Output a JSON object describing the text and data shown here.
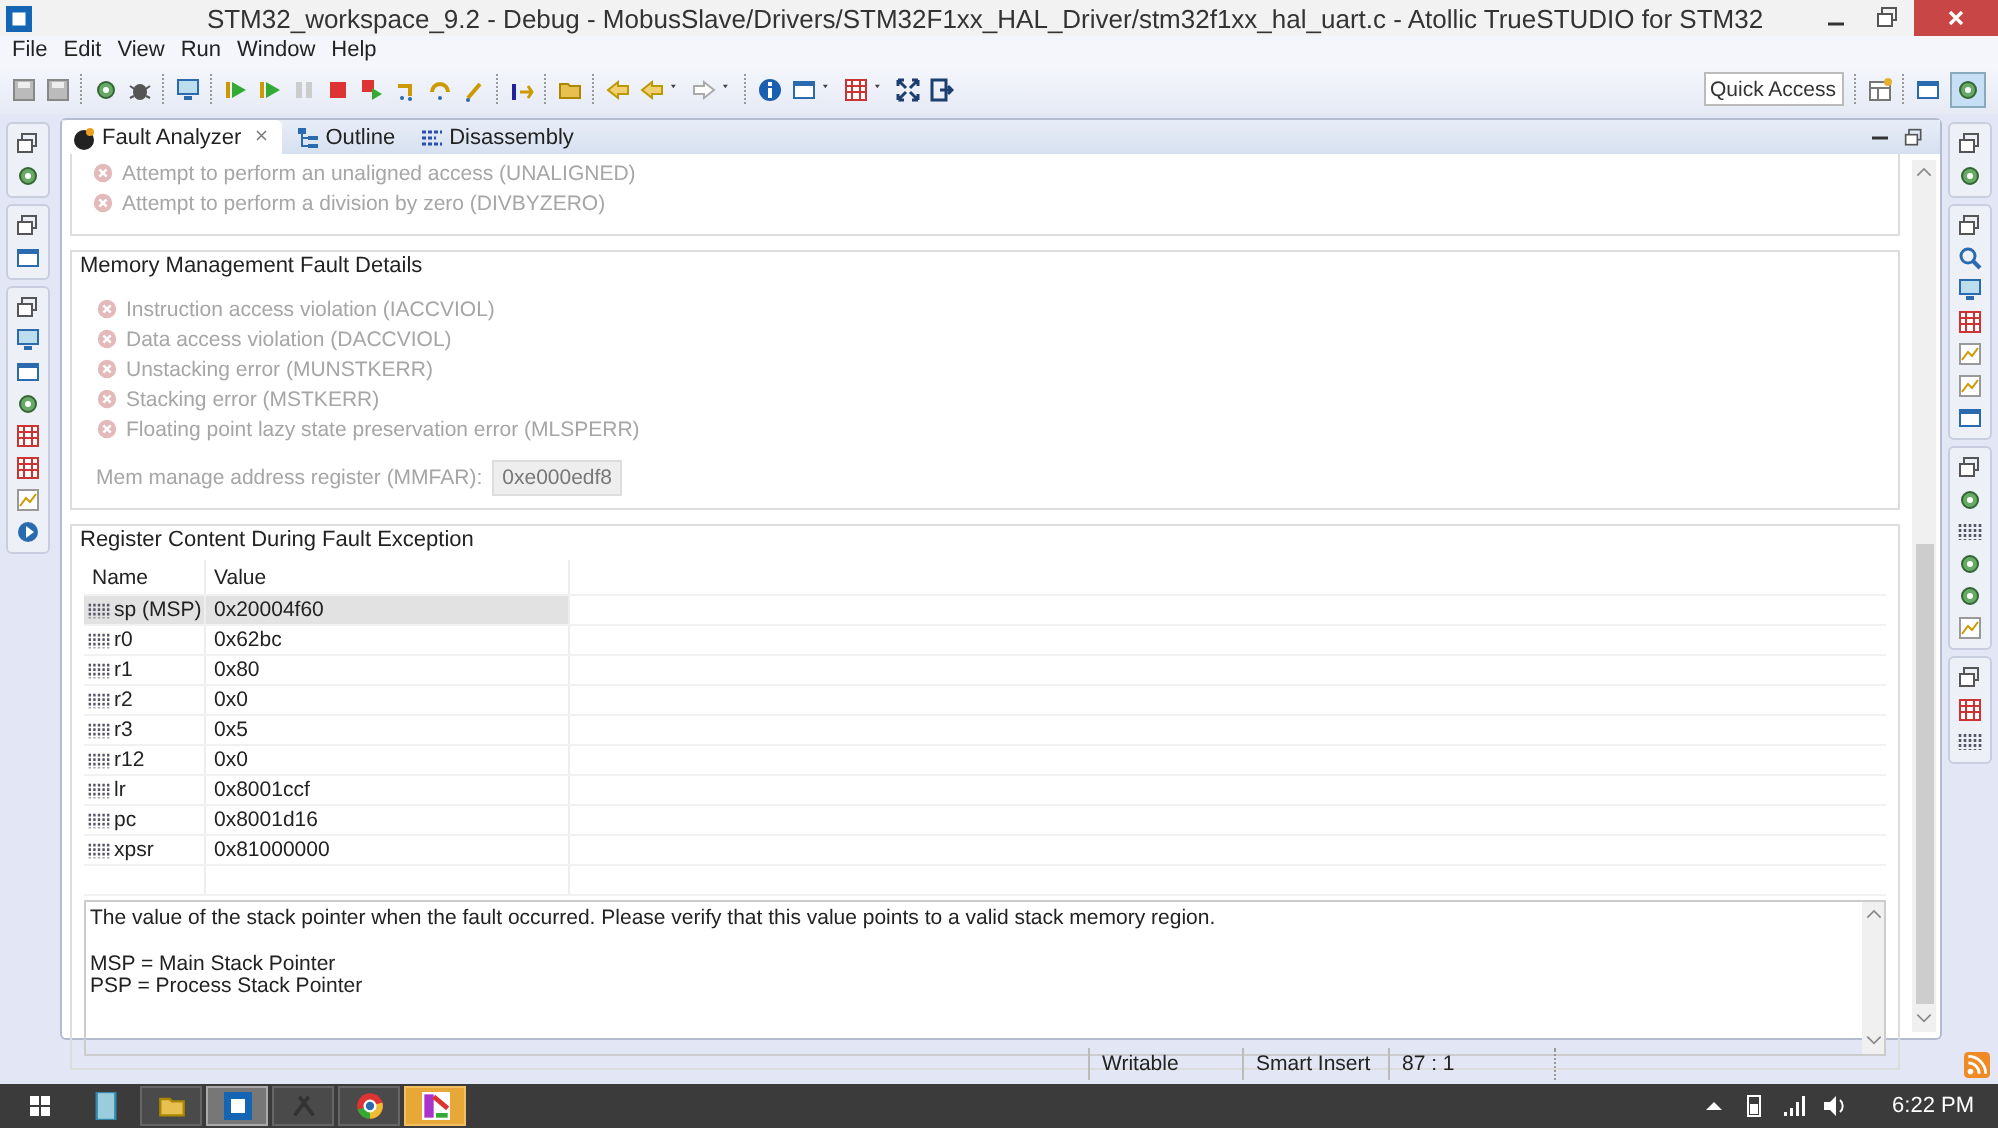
{
  "window": {
    "title": "STM32_workspace_9.2 - Debug - MobusSlave/Drivers/STM32F1xx_HAL_Driver/stm32f1xx_hal_uart.c - Atollic TrueSTUDIO for STM32"
  },
  "menu": [
    "File",
    "Edit",
    "View",
    "Run",
    "Window",
    "Help"
  ],
  "quick_access": {
    "placeholder": "Quick Access"
  },
  "tabs": [
    {
      "label": "Fault Analyzer",
      "selected": true
    },
    {
      "label": "Outline",
      "selected": false
    },
    {
      "label": "Disassembly",
      "selected": false
    }
  ],
  "usage_fault_items": [
    {
      "label": "Attempt to perform an unaligned access (UNALIGNED)",
      "flagged": false
    },
    {
      "label": "Attempt to perform a division by zero (DIVBYZERO)",
      "flagged": false
    }
  ],
  "memory_fault": {
    "title": "Memory Management Fault Details",
    "items": [
      {
        "label": "Instruction access violation (IACCVIOL)",
        "flagged": false
      },
      {
        "label": "Data access violation (DACCVIOL)",
        "flagged": false
      },
      {
        "label": "Unstacking error (MUNSTKERR)",
        "flagged": false
      },
      {
        "label": "Stacking error (MSTKERR)",
        "flagged": false
      },
      {
        "label": "Floating point lazy state preservation error (MLSPERR)",
        "flagged": false
      }
    ],
    "address_label": "Mem manage address register (MMFAR):",
    "address_value": "0xe000edf8"
  },
  "registers": {
    "title": "Register Content During Fault Exception",
    "columns": [
      "Name",
      "Value"
    ],
    "rows": [
      {
        "name": "sp (MSP)",
        "value": "0x20004f60",
        "selected": true
      },
      {
        "name": "r0",
        "value": "0x62bc",
        "selected": false
      },
      {
        "name": "r1",
        "value": "0x80",
        "selected": false
      },
      {
        "name": "r2",
        "value": "0x0",
        "selected": false
      },
      {
        "name": "r3",
        "value": "0x5",
        "selected": false
      },
      {
        "name": "r12",
        "value": "0x0",
        "selected": false
      },
      {
        "name": "lr",
        "value": "0x8001ccf",
        "selected": false
      },
      {
        "name": "pc",
        "value": "0x8001d16",
        "selected": false
      },
      {
        "name": "xpsr",
        "value": "0x81000000",
        "selected": false
      }
    ],
    "description": {
      "paragraph": "The value of the stack pointer when the fault occurred. Please verify that this value points to a valid stack memory region.",
      "definitions": [
        "MSP = Main Stack Pointer",
        "PSP = Process Stack Pointer"
      ]
    }
  },
  "status_bar": [
    "Writable",
    "Smart Insert",
    "87 : 1"
  ],
  "taskbar": {
    "clock": "6:22 PM"
  }
}
